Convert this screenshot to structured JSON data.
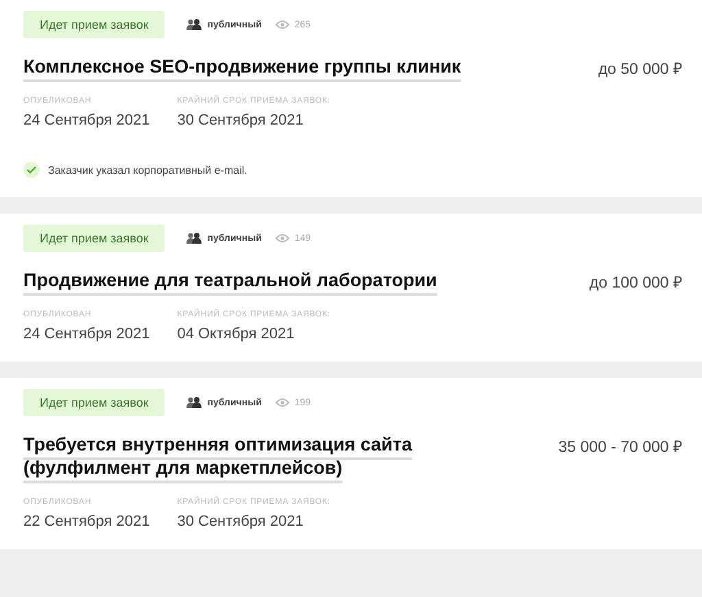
{
  "orders": [
    {
      "status": "Идет прием заявок",
      "visibility": "публичный",
      "views": "265",
      "title": "Комплексное SEO-продвижение группы клиник",
      "price": "до 50 000 ₽",
      "published_label": "ОПУБЛИКОВАН",
      "published": "24 Сентября 2021",
      "deadline_label": "КРАЙНИЙ СРОК ПРИЕМА ЗАЯВОК:",
      "deadline": "30 Сентября 2021",
      "note": "Заказчик указал корпоративный e-mail."
    },
    {
      "status": "Идет прием заявок",
      "visibility": "публичный",
      "views": "149",
      "title": "Продвижение для театральной лаборатории",
      "price": "до 100 000 ₽",
      "published_label": "ОПУБЛИКОВАН",
      "published": "24 Сентября 2021",
      "deadline_label": "КРАЙНИЙ СРОК ПРИЕМА ЗАЯВОК:",
      "deadline": "04 Октября 2021"
    },
    {
      "status": "Идет прием заявок",
      "visibility": "публичный",
      "views": "199",
      "title": "Требуется внутренняя оптимизация сайта (фулфилмент для маркетплейсов)",
      "price": "35 000 - 70 000 ₽",
      "published_label": "ОПУБЛИКОВАН",
      "published": "22 Сентября 2021",
      "deadline_label": "КРАЙНИЙ СРОК ПРИЕМА ЗАЯВОК:",
      "deadline": "30 Сентября 2021"
    }
  ]
}
